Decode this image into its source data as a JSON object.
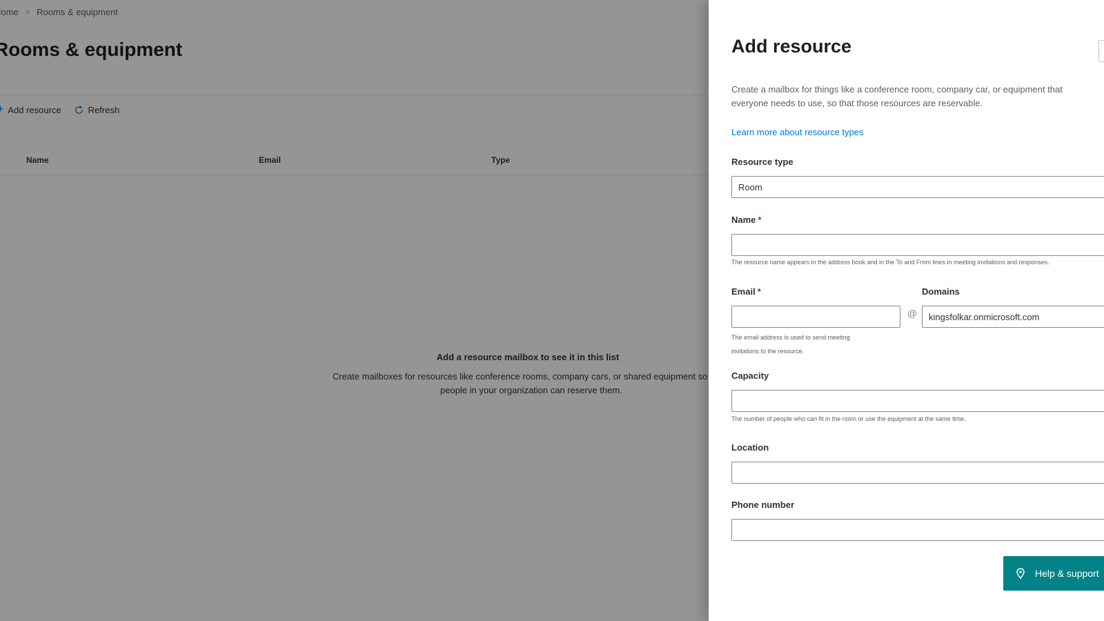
{
  "breadcrumb": {
    "items": [
      "Home",
      "Rooms & equipment"
    ]
  },
  "page": {
    "title": "Rooms & equipment"
  },
  "commandbar": {
    "add_label": "Add resource",
    "refresh_label": "Refresh"
  },
  "table": {
    "columns": [
      "Name",
      "Email",
      "Type"
    ]
  },
  "empty_state": {
    "title": "Add a resource mailbox to see it in this list",
    "line1": "Create mailboxes for resources like conference rooms, company cars, or shared equipment so",
    "line2": "people in your organization can reserve them."
  },
  "panel": {
    "title": "Add resource",
    "description_line1": "Create a mailbox for things like a conference room, company car, or equipment that",
    "description_line2": "everyone needs to use, so that those resources are reservable.",
    "learn_more": "Learn more about resource types",
    "resource_type": {
      "label": "Resource type",
      "value": "Room"
    },
    "name": {
      "label": "Name",
      "required_mark": "*",
      "value": "",
      "helper": "The resource name appears in the address book and in the To and From lines in meeting invitations and responses."
    },
    "email": {
      "label": "Email",
      "required_mark": "*",
      "value": "",
      "helper_line1": "The email address is used to send meeting",
      "helper_line2": "invitations to the resource."
    },
    "domains": {
      "label": "Domains",
      "value": "kingsfolkar.onmicrosoft.com"
    },
    "at_symbol": "@",
    "capacity": {
      "label": "Capacity",
      "value": "",
      "helper": "The number of people who can fit in the room or use the equipment at the same time."
    },
    "location": {
      "label": "Location",
      "value": ""
    },
    "phone": {
      "label": "Phone number",
      "value": ""
    },
    "help_button": "Help & support"
  },
  "icons": {
    "refresh": "refresh-icon",
    "add": "add-icon",
    "chevron": "chevron-down-icon",
    "help": "pin-icon"
  },
  "colors": {
    "accent": "#0078d4",
    "help_button": "#038387",
    "required": "#a4262c"
  }
}
